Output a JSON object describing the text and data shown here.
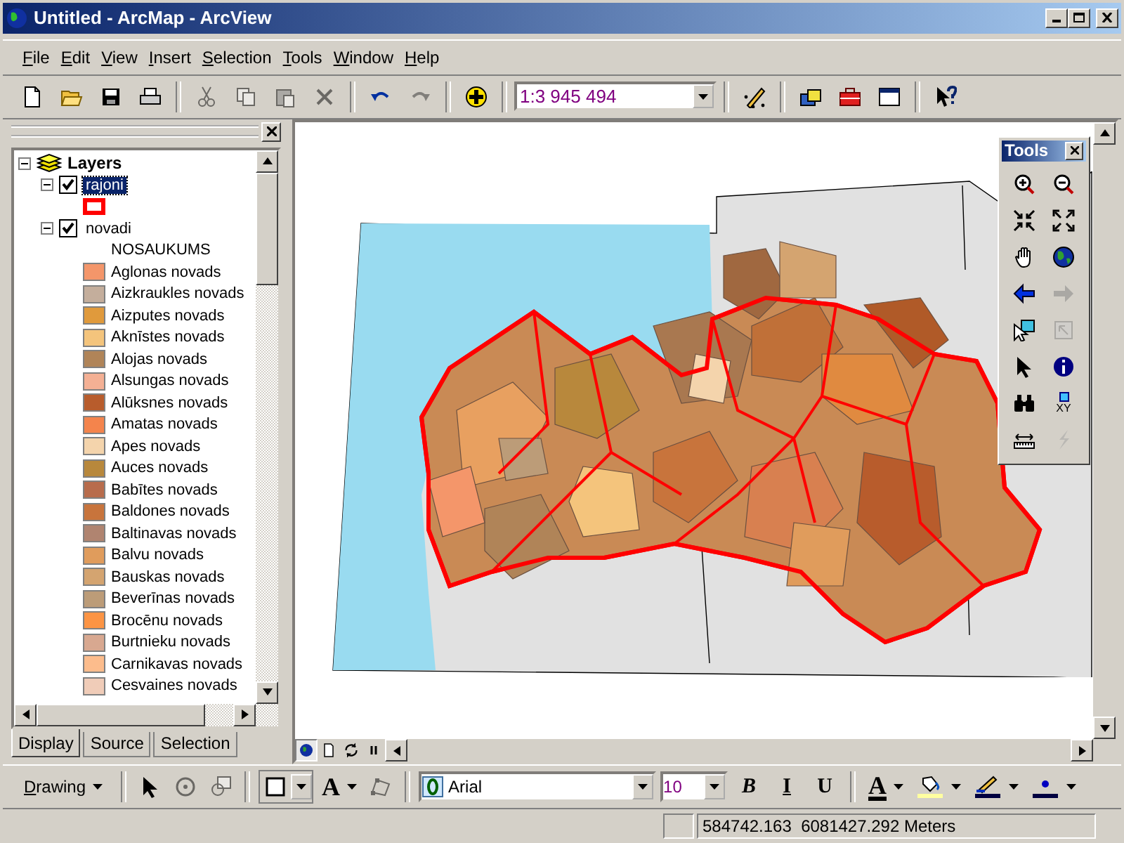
{
  "window": {
    "title": "Untitled - ArcMap - ArcView"
  },
  "menu": [
    "File",
    "Edit",
    "View",
    "Insert",
    "Selection",
    "Tools",
    "Window",
    "Help"
  ],
  "standard_toolbar": [
    {
      "kind": "new",
      "disabled": false
    },
    {
      "kind": "open",
      "disabled": false
    },
    {
      "kind": "save",
      "disabled": false
    },
    {
      "kind": "print",
      "disabled": false
    },
    {
      "kind": "sep"
    },
    {
      "kind": "cut",
      "disabled": true
    },
    {
      "kind": "copy",
      "disabled": true
    },
    {
      "kind": "paste",
      "disabled": true
    },
    {
      "kind": "delete",
      "disabled": true
    },
    {
      "kind": "sep"
    },
    {
      "kind": "undo",
      "disabled": false
    },
    {
      "kind": "redo",
      "disabled": true
    },
    {
      "kind": "sep"
    },
    {
      "kind": "add_data",
      "disabled": false
    },
    {
      "kind": "sep"
    },
    {
      "kind": "scale",
      "value": "1:3 945 494"
    },
    {
      "kind": "sep"
    },
    {
      "kind": "editor",
      "disabled": false
    },
    {
      "kind": "sep"
    },
    {
      "kind": "toolbox",
      "disabled": false
    },
    {
      "kind": "tool_case",
      "disabled": false
    },
    {
      "kind": "window",
      "disabled": false
    },
    {
      "kind": "sep"
    },
    {
      "kind": "whats_this",
      "disabled": false
    }
  ],
  "toc": {
    "label": "Layers",
    "expanded": true,
    "layers": [
      {
        "label": "rajoni",
        "checked": true,
        "selected": true,
        "expanded": true,
        "symbol": {
          "kind": "outline",
          "color": "#ff0000"
        }
      },
      {
        "label": "novadi",
        "checked": true,
        "selected": false,
        "expanded": true,
        "field": "NOSAUKUMS",
        "classes": [
          {
            "label": "Aglonas novads",
            "color": "#f4966a"
          },
          {
            "label": "Aizkraukles novads",
            "color": "#c4ae9c"
          },
          {
            "label": "Aizputes novads",
            "color": "#e09a3c"
          },
          {
            "label": "Aknīstes novads",
            "color": "#f4c47c"
          },
          {
            "label": "Alojas novads",
            "color": "#b08458"
          },
          {
            "label": "Alsungas novads",
            "color": "#f4b094"
          },
          {
            "label": "Alūksnes novads",
            "color": "#b85c2c"
          },
          {
            "label": "Amatas novads",
            "color": "#f4844c"
          },
          {
            "label": "Apes novads",
            "color": "#f4d4ac"
          },
          {
            "label": "Auces novads",
            "color": "#b8883c"
          },
          {
            "label": "Babītes novads",
            "color": "#b86c4c"
          },
          {
            "label": "Baldones novads",
            "color": "#c8743c"
          },
          {
            "label": "Baltinavas novads",
            "color": "#b08470"
          },
          {
            "label": "Balvu novads",
            "color": "#e09c5c"
          },
          {
            "label": "Bauskas novads",
            "color": "#d4a470"
          },
          {
            "label": "Beverīnas novads",
            "color": "#bc9c78"
          },
          {
            "label": "Brocēnu novads",
            "color": "#fc9444"
          },
          {
            "label": "Burtnieku novads",
            "color": "#d8a890"
          },
          {
            "label": "Carnikavas novads",
            "color": "#fcbc8c"
          },
          {
            "label": "Cesvaines novads",
            "color": "#f0ccb8"
          }
        ]
      }
    ]
  },
  "toc_tabs": [
    {
      "label": "Display",
      "selected": true
    },
    {
      "label": "Source",
      "selected": false
    },
    {
      "label": "Selection",
      "selected": false
    }
  ],
  "map_view_buttons": [
    {
      "kind": "data_view",
      "selected": true
    },
    {
      "kind": "layout_view",
      "selected": false
    },
    {
      "kind": "refresh",
      "selected": false
    },
    {
      "kind": "pause",
      "selected": false
    }
  ],
  "tools_palette": {
    "title": "Tools",
    "tools": [
      {
        "kind": "zoom_in",
        "disabled": false
      },
      {
        "kind": "zoom_out",
        "disabled": false
      },
      {
        "kind": "fixed_zoom_in",
        "disabled": false
      },
      {
        "kind": "fixed_zoom_out",
        "disabled": false
      },
      {
        "kind": "pan",
        "disabled": false
      },
      {
        "kind": "full_extent",
        "disabled": false
      },
      {
        "kind": "back",
        "disabled": false
      },
      {
        "kind": "forward",
        "disabled": true
      },
      {
        "kind": "select_features",
        "disabled": false
      },
      {
        "kind": "select_elements",
        "disabled": true
      },
      {
        "kind": "pointer",
        "disabled": false
      },
      {
        "kind": "identify",
        "disabled": false
      },
      {
        "kind": "find",
        "disabled": false
      },
      {
        "kind": "goto_xy",
        "disabled": false,
        "label": "XY"
      },
      {
        "kind": "measure",
        "disabled": false
      },
      {
        "kind": "hyperlink",
        "disabled": true
      }
    ]
  },
  "drawing_toolbar": [
    {
      "kind": "menu",
      "label": "Drawing"
    },
    {
      "kind": "sep"
    },
    {
      "kind": "pointer",
      "disabled": false
    },
    {
      "kind": "rotate",
      "disabled": true
    },
    {
      "kind": "zoom_selected",
      "disabled": true
    },
    {
      "kind": "sep"
    },
    {
      "kind": "shape_picker"
    },
    {
      "kind": "text_tool",
      "label": "A"
    },
    {
      "kind": "edit_vertices",
      "disabled": true
    },
    {
      "kind": "sep"
    },
    {
      "kind": "font",
      "value": "Arial"
    },
    {
      "kind": "size",
      "value": "10"
    },
    {
      "kind": "style",
      "label": "B"
    },
    {
      "kind": "style",
      "label": "I"
    },
    {
      "kind": "style",
      "label": "U"
    },
    {
      "kind": "sep"
    },
    {
      "kind": "font_color",
      "label": "A"
    },
    {
      "kind": "fill_color"
    },
    {
      "kind": "line_color"
    },
    {
      "kind": "marker_color"
    }
  ],
  "status_bar": {
    "coordinates": "584742.163  6081427.292 Meters"
  }
}
